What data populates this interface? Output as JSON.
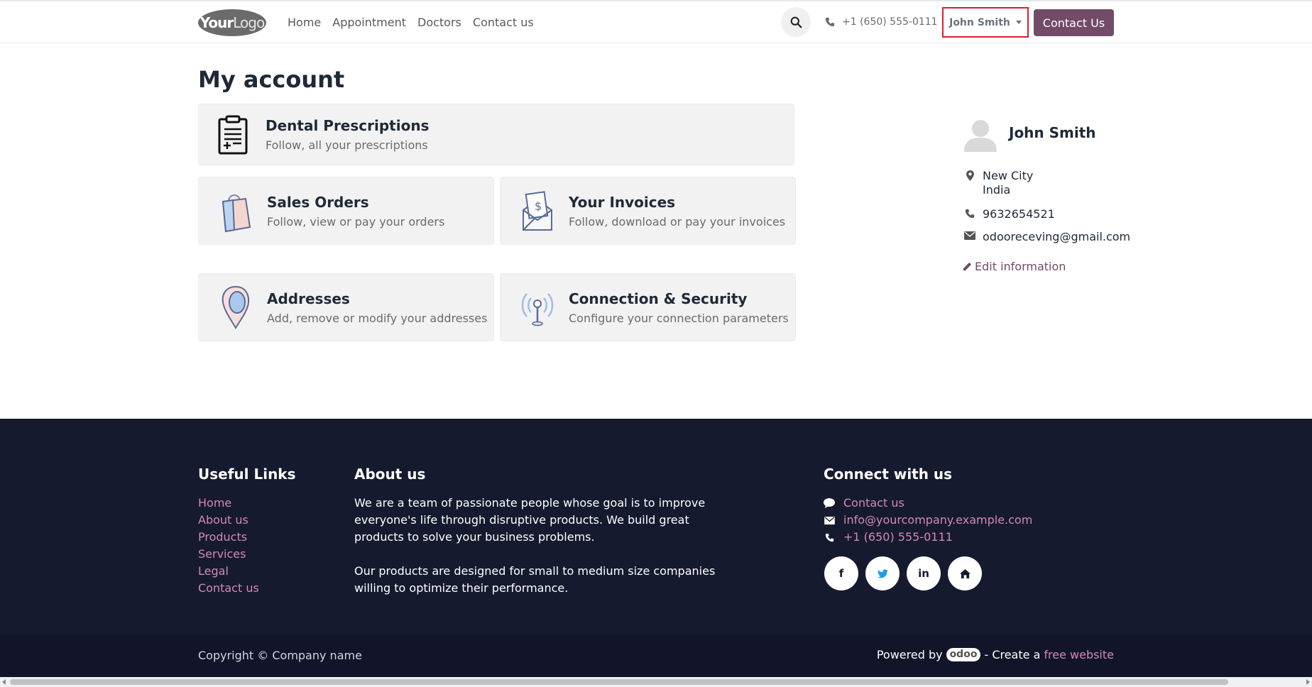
{
  "header": {
    "logo_text_bold": "Your",
    "logo_text_light": "Logo",
    "nav": [
      "Home",
      "Appointment",
      "Doctors",
      "Contact us"
    ],
    "phone": "+1 (650) 555-0111",
    "user_name": "John Smith",
    "contact_button": "Contact Us"
  },
  "main": {
    "title": "My account",
    "cards": {
      "prescriptions": {
        "title": "Dental Prescriptions",
        "subtitle": "Follow, all your prescriptions"
      },
      "sales": {
        "title": "Sales Orders",
        "subtitle": "Follow, view or pay your orders"
      },
      "invoices": {
        "title": "Your Invoices",
        "subtitle": "Follow, download or pay your invoices"
      },
      "addresses": {
        "title": "Addresses",
        "subtitle": "Add, remove or modify your addresses"
      },
      "security": {
        "title": "Connection & Security",
        "subtitle": "Configure your connection parameters"
      }
    }
  },
  "profile": {
    "name": "John Smith",
    "city": "New City",
    "country": "India",
    "phone": "9632654521",
    "email": "odooreceving@gmail.com",
    "edit_label": "Edit information"
  },
  "footer": {
    "useful_links_title": "Useful Links",
    "useful_links": [
      "Home",
      "About us",
      "Products",
      "Services",
      "Legal",
      "Contact us"
    ],
    "about_title": "About us",
    "about_p1": "We are a team of passionate people whose goal is to improve everyone's life through disruptive products. We build great products to solve your business problems.",
    "about_p2": "Our products are designed for small to medium size companies willing to optimize their performance.",
    "connect_title": "Connect with us",
    "connect_contact": "Contact us",
    "connect_email": "info@yourcompany.example.com",
    "connect_phone": "+1 (650) 555-0111",
    "socials": {
      "facebook": "f",
      "linkedin": "in"
    },
    "copyright": "Copyright © Company name",
    "powered_by": "Powered by",
    "odoo": "odoo",
    "create_a": "- Create a",
    "free_website": "free website"
  },
  "colors": {
    "brand": "#714B67",
    "footer_bg": "#161a2e",
    "link": "#d189b8"
  }
}
